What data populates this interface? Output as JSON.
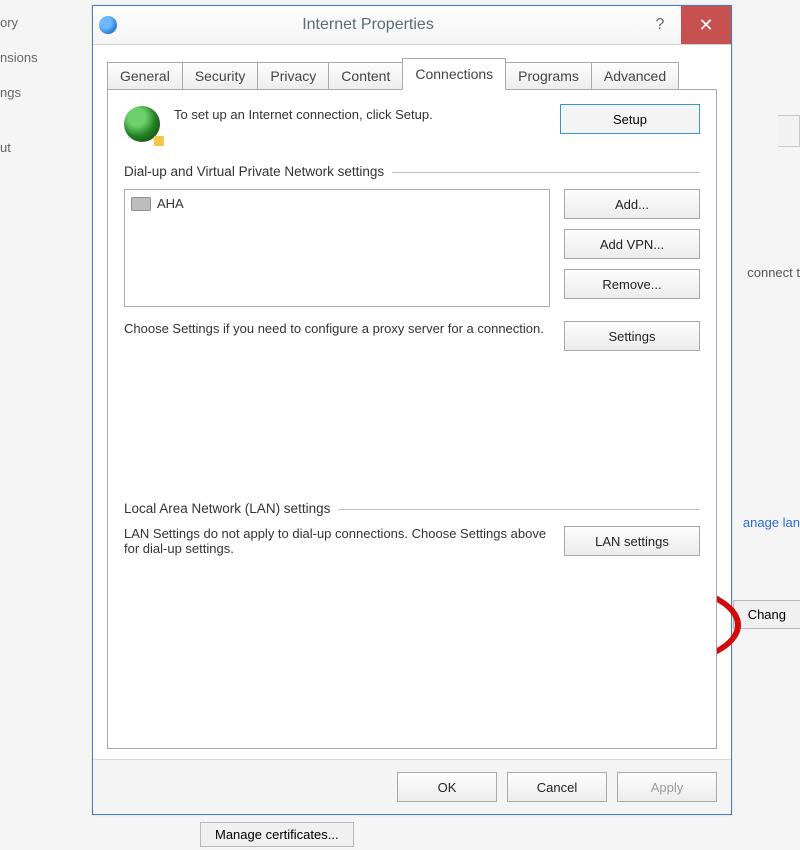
{
  "background": {
    "left_items": [
      "ory",
      "nsions",
      "ngs",
      "ut"
    ],
    "right_items": {
      "connect": "connect t",
      "lang": "anage lan",
      "change_btn": "Chang"
    },
    "manage_certificates": "Manage certificates..."
  },
  "titlebar": {
    "title": "Internet Properties"
  },
  "tabs": [
    "General",
    "Security",
    "Privacy",
    "Content",
    "Connections",
    "Programs",
    "Advanced"
  ],
  "active_tab": "Connections",
  "setup": {
    "text": "To set up an Internet connection, click Setup.",
    "button": "Setup"
  },
  "dialup": {
    "header": "Dial-up and Virtual Private Network settings",
    "items": [
      "AHA"
    ],
    "add": "Add...",
    "add_vpn": "Add VPN...",
    "remove": "Remove...",
    "choose_text": "Choose Settings if you need to configure a proxy server for a connection.",
    "settings": "Settings"
  },
  "lan": {
    "header": "Local Area Network (LAN) settings",
    "text": "LAN Settings do not apply to dial-up connections. Choose Settings above for dial-up settings.",
    "button": "LAN settings"
  },
  "footer": {
    "ok": "OK",
    "cancel": "Cancel",
    "apply": "Apply"
  }
}
